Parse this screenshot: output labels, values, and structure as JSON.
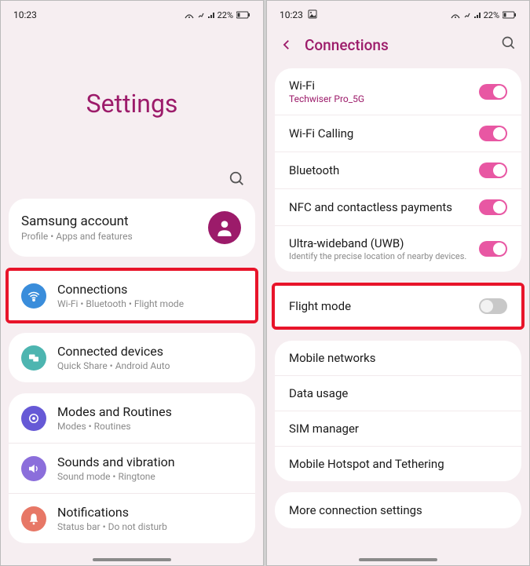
{
  "left": {
    "status": {
      "time": "10:23",
      "battery": "22%"
    },
    "title": "Settings",
    "account": {
      "title": "Samsung account",
      "sub": "Profile  •  Apps and features"
    },
    "connections": {
      "title": "Connections",
      "sub": "Wi-Fi  •  Bluetooth  •  Flight mode"
    },
    "connected_devices": {
      "title": "Connected devices",
      "sub": "Quick Share  •  Android Auto"
    },
    "modes": {
      "title": "Modes and Routines",
      "sub": "Modes  •  Routines"
    },
    "sounds": {
      "title": "Sounds and vibration",
      "sub": "Sound mode  •  Ringtone"
    },
    "notifications": {
      "title": "Notifications",
      "sub": "Status bar  •  Do not disturb"
    }
  },
  "right": {
    "status": {
      "time": "10:23",
      "battery": "22%"
    },
    "header": "Connections",
    "wifi": {
      "title": "Wi-Fi",
      "sub": "Techwiser Pro_5G"
    },
    "wifi_calling": {
      "title": "Wi-Fi Calling"
    },
    "bluetooth": {
      "title": "Bluetooth"
    },
    "nfc": {
      "title": "NFC and contactless payments"
    },
    "uwb": {
      "title": "Ultra-wideband (UWB)",
      "sub": "Identify the precise location of nearby devices."
    },
    "flight": {
      "title": "Flight mode"
    },
    "mobile_networks": {
      "title": "Mobile networks"
    },
    "data_usage": {
      "title": "Data usage"
    },
    "sim": {
      "title": "SIM manager"
    },
    "hotspot": {
      "title": "Mobile Hotspot and Tethering"
    },
    "more": {
      "title": "More connection settings"
    }
  }
}
